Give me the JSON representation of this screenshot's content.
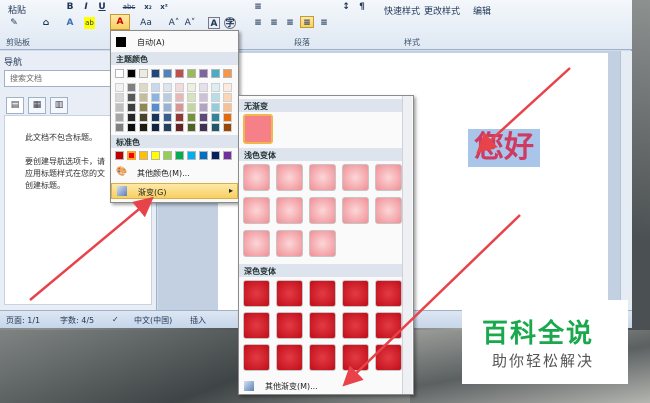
{
  "ribbon": {
    "paste_label": "粘贴",
    "clipboard_label": "剪贴板",
    "paragraph_label": "段落",
    "styles_label": "样式",
    "quick_styles_label": "快速样式",
    "change_styles_label": "更改样式",
    "edit_label": "编辑",
    "font_buttons": [
      "B",
      "I",
      "U",
      "abc",
      "x₂",
      "x²",
      "Aa",
      "A",
      "A",
      "A"
    ]
  },
  "nav": {
    "title": "导航",
    "search_placeholder": "搜索文档",
    "body_lines": [
      "此文档不包含标题。",
      "要创建导航选项卡，请",
      "应用标题样式在您的文",
      "创建标题。"
    ]
  },
  "document": {
    "text": "您好"
  },
  "status": {
    "page": "页面: 1/1",
    "words": "字数: 4/5",
    "language": "中文(中国)",
    "mode": "插入"
  },
  "color_menu": {
    "auto_label": "自动(A)",
    "theme_header": "主题颜色",
    "standard_header": "标准色",
    "more_colors_label": "其他颜色(M)...",
    "gradient_label": "渐变(G)",
    "theme_colors": [
      "#ffffff",
      "#000000",
      "#eeece1",
      "#1f497d",
      "#4f81bd",
      "#c0504d",
      "#9bbb59",
      "#8064a2",
      "#4bacc6",
      "#f79646"
    ],
    "theme_shades": [
      [
        "#f2f2f2",
        "#7f7f7f",
        "#ddd9c3",
        "#c6d9f0",
        "#dbe5f1",
        "#f2dcdb",
        "#ebf1dd",
        "#e5e0ec",
        "#dbeef3",
        "#fdeada"
      ],
      [
        "#d8d8d8",
        "#595959",
        "#c4bd97",
        "#8db3e2",
        "#b8cce4",
        "#e5b9b7",
        "#d7e3bc",
        "#ccc1d9",
        "#b7dde8",
        "#fbd5b5"
      ],
      [
        "#bfbfbf",
        "#3f3f3f",
        "#938953",
        "#548dd4",
        "#95b3d7",
        "#d99694",
        "#c3d69b",
        "#b2a2c7",
        "#92cddc",
        "#fac08f"
      ],
      [
        "#a5a5a5",
        "#262626",
        "#494429",
        "#17365d",
        "#366092",
        "#953734",
        "#76923c",
        "#5f497a",
        "#31859b",
        "#e36c09"
      ],
      [
        "#7f7f7f",
        "#0c0c0c",
        "#1d1b10",
        "#0f243e",
        "#244061",
        "#632423",
        "#4f6128",
        "#3f3151",
        "#205867",
        "#974806"
      ]
    ],
    "standard_colors": [
      "#c00000",
      "#ff0000",
      "#ffc000",
      "#ffff00",
      "#92d050",
      "#00b050",
      "#00b0f0",
      "#0070c0",
      "#002060",
      "#7030a0"
    ]
  },
  "gradient_menu": {
    "no_gradient_header": "无渐变",
    "light_header": "浅色变体",
    "dark_header": "深色变体",
    "more_gradients_label": "其他渐变(M)..."
  },
  "logo": {
    "main": "百科全说",
    "sub": "助你轻松解决"
  }
}
